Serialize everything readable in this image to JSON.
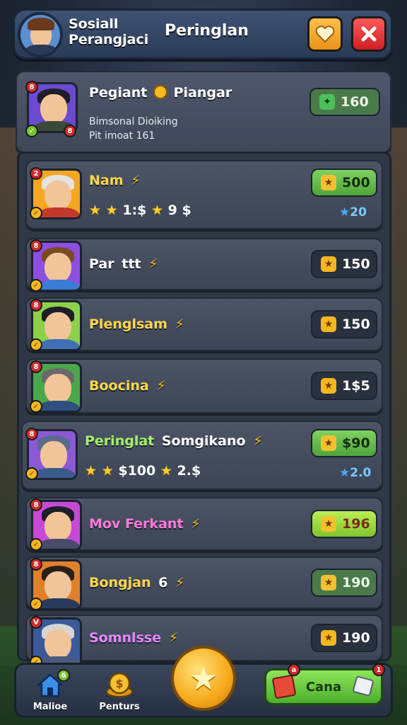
{
  "header": {
    "title": "Sosiall Perangjaci",
    "center_title": "Peringlan",
    "heart_icon": "heart-icon",
    "close_icon": "close-icon"
  },
  "top_player": {
    "name": "Pegiant",
    "name_suffix": "Piangar",
    "line1": "Bimsonal Dioiking",
    "line2": "Pit imoat 161",
    "score": "160",
    "badge_tl": "8",
    "badge_bl": "",
    "badge_br": "8"
  },
  "players": [
    {
      "name": "Nam",
      "name_color": "#ffd84a",
      "score": "500",
      "pill": "green",
      "stars_text": "1:$ ",
      "stars_tail": "9 $",
      "bonus": "20",
      "badge_tl": "2",
      "badge_br": "8",
      "bg": "#f5a623",
      "hair": "#e3e3e3",
      "body": "#c0392b"
    },
    {
      "name": "Par",
      "name_suffix": "ttt",
      "name_color": "#ffffff",
      "score": "150",
      "pill": "dark",
      "badge_tl": "8",
      "badge_bl": "8",
      "bg": "#8e4ee0",
      "hair": "#7a4a22",
      "body": "#3a7bd5"
    },
    {
      "name": "Plenglsam",
      "name_color": "#ffd84a",
      "score": "150",
      "pill": "dark",
      "badge_tl": "8",
      "badge_bl": "8",
      "bg": "#8bd14a",
      "hair": "#1e1e2a",
      "body": "#3f6fb5"
    },
    {
      "name": "Boocina",
      "name_color": "#ffd84a",
      "score": "1$5",
      "pill": "dark",
      "badge_tl": "8",
      "badge_bl": "8",
      "bg": "#4aa84a",
      "hair": "#6a6a6a",
      "body": "#2f4f7f"
    },
    {
      "name": "Peringlat",
      "name_suffix": "Somgikano",
      "name_color": "#a6f06a",
      "score": "$90",
      "pill": "green",
      "stars_text": "$100 ",
      "stars_tail": "2.$",
      "bonus": "2.0",
      "badge_tl": "8",
      "badge_bl": "",
      "bg": "#8a5ad6",
      "hair": "#5a6a8a",
      "body": "#3a5a8a"
    },
    {
      "name": "Mov Ferkant",
      "name_color": "#ff7ad9",
      "score": "196",
      "pill": "lime",
      "badge_tl": "8",
      "badge_bl": "8",
      "bg": "#c64ad6",
      "hair": "#1e1e2a",
      "body": "#4a4a6a"
    },
    {
      "name": "Bongjan",
      "name_suffix": "6",
      "name_color": "#ffd84a",
      "score": "190",
      "pill": "darkgreen",
      "badge_tl": "8",
      "badge_bl": "8",
      "bg": "#e0812a",
      "hair": "#2a1e1a",
      "body": "#2a3a5a"
    },
    {
      "name": "Somnlsse",
      "name_color": "#e58aff",
      "score": "190",
      "pill": "dark",
      "badge_tl": "V",
      "badge_bl": "",
      "bg": "#3a5a9a",
      "hair": "#d5d5d5",
      "body": "#4a5a7a"
    }
  ],
  "bottom_nav": {
    "home_label": "Malioe",
    "home_badge": "6",
    "rewards_label": "Penturs",
    "cta_label": "Cana",
    "cta_badge": "a",
    "cta_badge2": "1"
  }
}
